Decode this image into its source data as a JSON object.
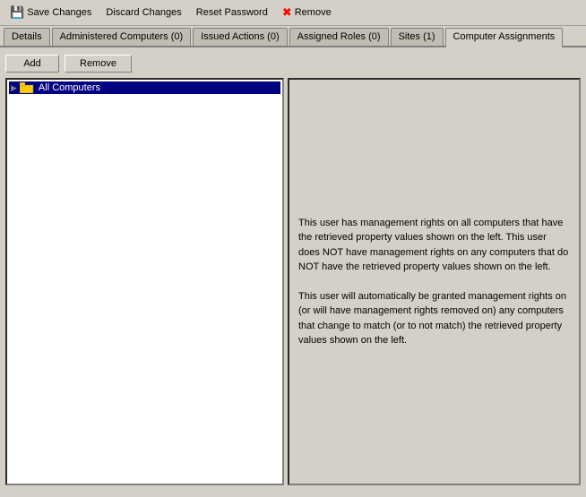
{
  "toolbar": {
    "save_label": "Save Changes",
    "discard_label": "Discard Changes",
    "reset_label": "Reset Password",
    "remove_label": "Remove"
  },
  "tabs": [
    {
      "id": "details",
      "label": "Details"
    },
    {
      "id": "administered-computers",
      "label": "Administered Computers (0)"
    },
    {
      "id": "issued-actions",
      "label": "Issued Actions (0)"
    },
    {
      "id": "assigned-roles",
      "label": "Assigned Roles (0)"
    },
    {
      "id": "sites",
      "label": "Sites (1)"
    },
    {
      "id": "computer-assignments",
      "label": "Computer Assignments"
    }
  ],
  "active_tab": "computer-assignments",
  "buttons": {
    "add": "Add",
    "remove": "Remove"
  },
  "tree": {
    "items": [
      {
        "label": "All Computers",
        "selected": true
      }
    ]
  },
  "description": {
    "paragraph1": "This user has management rights on all computers that have the retrieved property values shown on the left. This user does NOT have management rights on any computers that do NOT have the retrieved property values shown on the left.",
    "paragraph2": "This user will automatically be granted management rights on (or will have management rights removed on) any computers that change to match (or to not match) the retrieved property values shown on the left."
  }
}
